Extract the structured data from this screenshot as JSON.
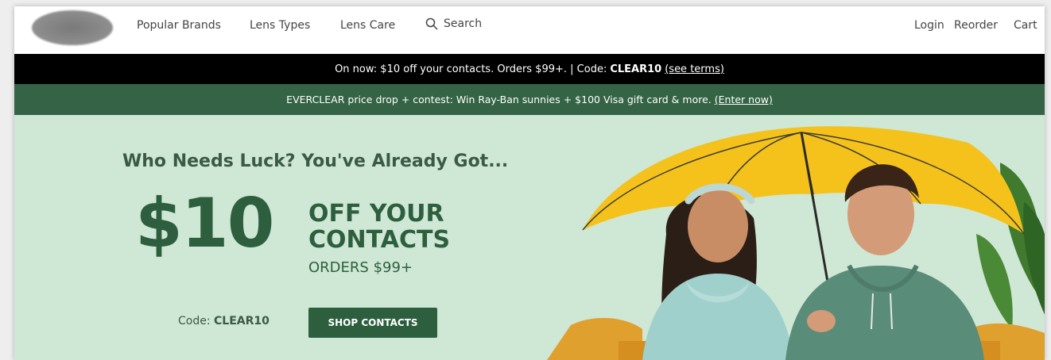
{
  "nav": {
    "popular_brands": "Popular Brands",
    "lens_types": "Lens Types",
    "lens_care": "Lens Care",
    "search": "Search",
    "login": "Login",
    "reorder": "Reorder",
    "cart": "Cart"
  },
  "promo_black": {
    "text": "On now: $10 off your contacts. Orders $99+. | Code:",
    "code": "CLEAR10",
    "terms_link": "(see terms)"
  },
  "promo_green": {
    "text": "EVERCLEAR price drop + contest: Win Ray-Ban sunnies + $100 Visa gift card & more.",
    "enter_link": "(Enter now)"
  },
  "hero": {
    "headline": "Who Needs Luck? You've Already Got...",
    "amount": "$10",
    "off_line1": "OFF YOUR",
    "off_line2": "CONTACTS",
    "orders": "ORDERS $99+",
    "code_label": "Code:",
    "code_value": "CLEAR10",
    "shop_button": "SHOP CONTACTS"
  },
  "colors": {
    "nav_bg": "#ffffff",
    "promo_black_bg": "#000000",
    "promo_green_bg": "#346345",
    "hero_bg": "#cfe7d5",
    "brand_green": "#2d5f3f",
    "umbrella_yellow": "#f4c21a"
  },
  "icons": {
    "search": "magnifier-icon"
  }
}
